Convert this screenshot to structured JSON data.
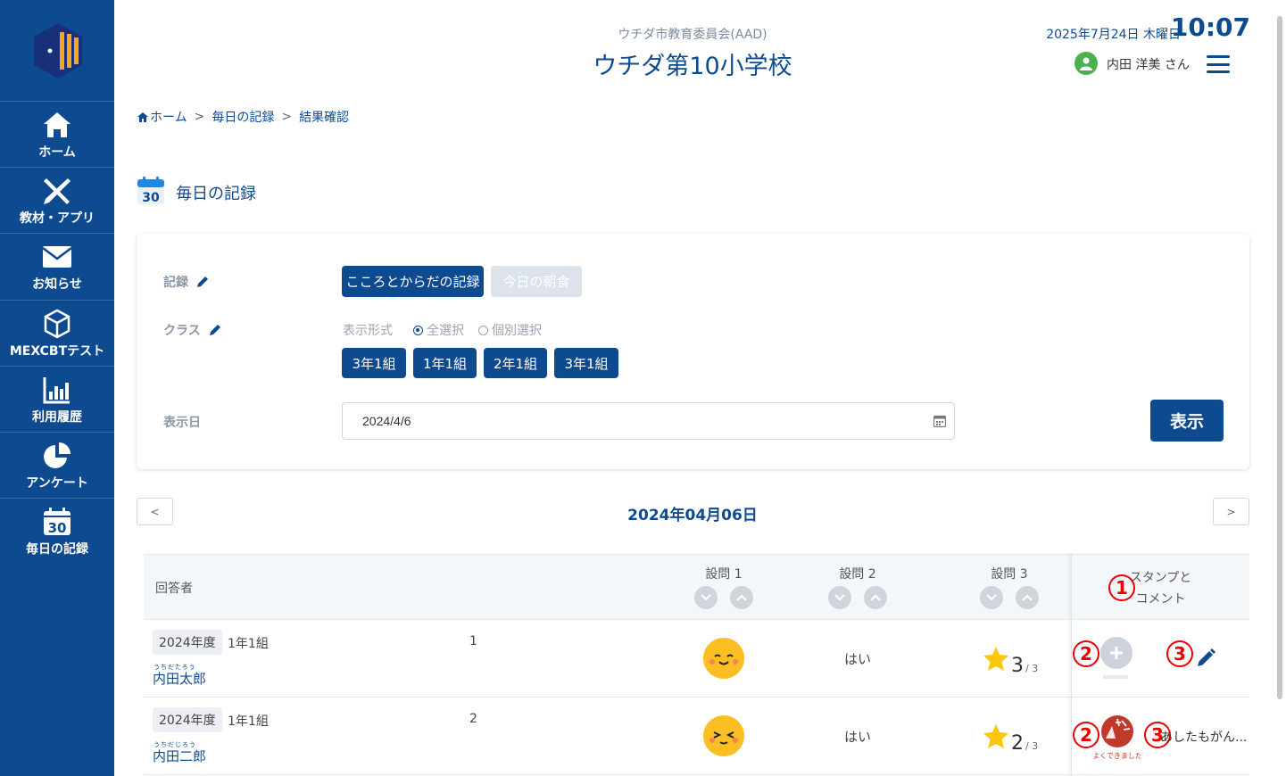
{
  "sidebar": {
    "items": [
      {
        "label": "ホーム",
        "icon": "home-icon"
      },
      {
        "label": "教材・アプリ",
        "icon": "pencil-ruler-icon"
      },
      {
        "label": "お知らせ",
        "icon": "mail-icon"
      },
      {
        "label": "MEXCBTテスト",
        "icon": "cube-icon"
      },
      {
        "label": "利用履歴",
        "icon": "bar-chart-icon"
      },
      {
        "label": "アンケート",
        "icon": "pie-chart-icon"
      },
      {
        "label": "毎日の記録",
        "icon": "calendar-30-icon"
      }
    ]
  },
  "header": {
    "org": "ウチダ市教育委員会(AAD)",
    "school": "ウチダ第10小学校",
    "date": "2025年7月24日 木曜日",
    "time": "10:07",
    "user": "内田 洋美 さん"
  },
  "breadcrumb": [
    "ホーム",
    "毎日の記録",
    "結果確認"
  ],
  "breadcrumb_sep": ">",
  "page_title": "毎日の記録",
  "calendar_day": "30",
  "filter": {
    "record_label": "記録",
    "record_options": [
      "こころとからだの記録",
      "今日の朝食"
    ],
    "class_label": "クラス",
    "display_mode_label": "表示形式",
    "radio_all": "全選択",
    "radio_individual": "個別選択",
    "classes": [
      "3年1組",
      "1年1組",
      "2年1組",
      "3年1組"
    ],
    "date_label": "表示日",
    "date_value": "2024/4/6",
    "show_button": "表示"
  },
  "date_nav": {
    "prev": "<",
    "next": ">",
    "current": "2024年04月06日"
  },
  "table": {
    "respondent_header": "回答者",
    "questions": [
      "設問 1",
      "設問 2",
      "設問 3"
    ],
    "stamp_header_line1": "スタンプと",
    "stamp_header_line2": "コメント",
    "rows": [
      {
        "year": "2024年度",
        "class": "1年1組",
        "ruby": "うちだたろう",
        "name": "内田太郎",
        "number": "1",
        "q1": "smile",
        "q2": "はい",
        "q3_score": "3",
        "q3_max": "/ 3",
        "comment": ""
      },
      {
        "year": "2024年度",
        "class": "1年1組",
        "ruby": "うちだじろう",
        "name": "内田二郎",
        "number": "2",
        "q1": "squint",
        "q2": "はい",
        "q3_score": "2",
        "q3_max": "/ 3",
        "comment": "あしたもがん..."
      }
    ]
  },
  "annotations": [
    "1",
    "2",
    "3"
  ],
  "stamp_caption": "よくできました",
  "colors": {
    "primary": "#0d4a8f",
    "annotation": "#ee0000",
    "face": "#fbbf24",
    "star": "#f9c80e"
  }
}
